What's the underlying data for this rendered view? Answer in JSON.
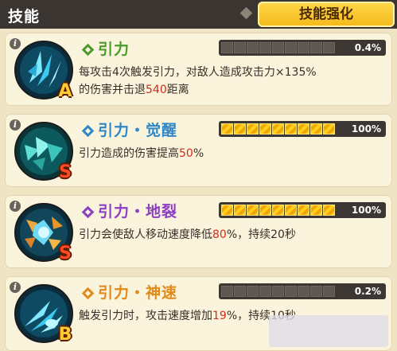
{
  "header": {
    "title": "技能",
    "tab_label": "技能强化"
  },
  "skills": [
    {
      "name": "引力",
      "name_color": "#4b9a2a",
      "grade": "A",
      "progress_label": "0.4%",
      "progress_fraction": 0.004,
      "desc_line1": "每攻击4次触发引力，对敌人造成攻击力×135%",
      "desc_line2_pre": "的伤害并击退",
      "desc_line2_value": "540",
      "desc_line2_post": "距离",
      "icon": "gravity-shards-icon"
    },
    {
      "name": "引力・觉醒",
      "name_color": "#2f87c8",
      "grade": "S",
      "progress_label": "100%",
      "progress_fraction": 1.0,
      "desc_pre": "引力造成的伤害提高",
      "desc_value": "50",
      "desc_post": "%",
      "icon": "gravity-awaken-icon"
    },
    {
      "name": "引力・地裂",
      "name_color": "#8b3fc4",
      "grade": "S",
      "progress_label": "100%",
      "progress_fraction": 1.0,
      "desc_pre": "引力会使敌人移动速度降低",
      "desc_value": "80",
      "desc_post": "%，持续20秒",
      "icon": "gravity-quake-icon"
    },
    {
      "name": "引力・神速",
      "name_color": "#e08a1a",
      "grade": "B",
      "progress_label": "0.2%",
      "progress_fraction": 0.002,
      "desc_pre": "触发引力时，攻击速度增加",
      "desc_value": "19",
      "desc_post": "%，持续10秒",
      "icon": "gravity-haste-icon"
    }
  ],
  "colors": {
    "header_bg": "#3b3532",
    "tab_gold": "#f4b91a",
    "highlight_red": "#d62a1c",
    "bar_fill": "#ffce1f"
  }
}
